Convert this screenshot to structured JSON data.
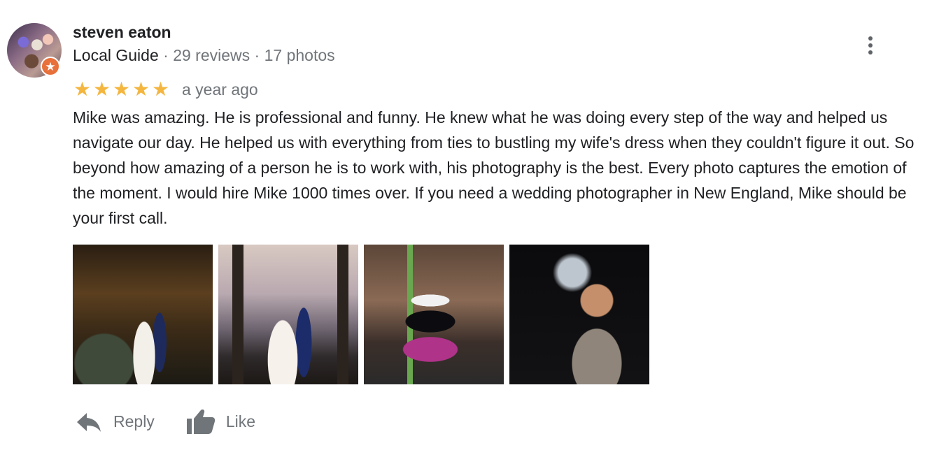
{
  "review": {
    "author": {
      "name": "steven eaton",
      "badge": "Local Guide",
      "separator": "·",
      "reviews_count": "29 reviews",
      "photos_count": "17 photos"
    },
    "rating": {
      "stars": 5,
      "star_glyph": "★",
      "date": "a year ago"
    },
    "text": "Mike was amazing. He is professional and funny. He knew what he was doing every step of the way and helped us navigate our day. He helped us with everything from ties to bustling my wife's dress when they couldn't figure it out. So beyond how amazing of a person he is to work with, his photography is the best. Every photo captures the emotion of the moment. I would hire Mike 1000 times over. If you need a wedding photographer in New England, Mike should be your first call.",
    "actions": {
      "reply_label": "Reply",
      "like_label": "Like"
    }
  },
  "colors": {
    "star": "#f4b63f",
    "muted_text": "#70757a",
    "primary_text": "#202124",
    "guide_badge": "#e8703a"
  }
}
